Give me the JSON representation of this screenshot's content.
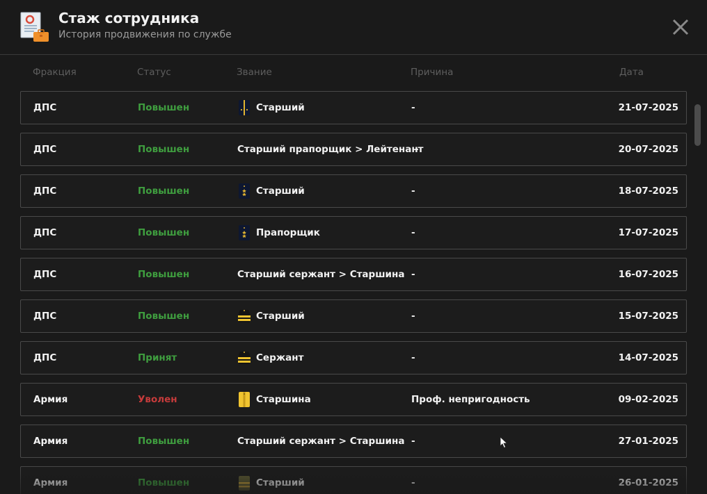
{
  "header": {
    "title": "Стаж сотрудника",
    "subtitle": "История продвижения по службе",
    "app_icon": "certificate-briefcase-icon",
    "close_icon": "close-icon"
  },
  "columns": {
    "faction": "Фракция",
    "status": "Статус",
    "rank": "Звание",
    "reason": "Причина",
    "date": "Дата"
  },
  "colors": {
    "promoted": "#3f9e3f",
    "fired": "#c63b3b",
    "background": "#1a1a1a"
  },
  "rows": [
    {
      "faction": "ДПС",
      "status": "Повышен",
      "status_type": "up",
      "rank_icon": "shoulder-strap-dark-one-stripe",
      "rank": "Старший",
      "reason": "-",
      "date": "21-07-2025"
    },
    {
      "faction": "ДПС",
      "status": "Повышен",
      "status_type": "up",
      "rank_icon": "",
      "rank": "Старший прапорщик > Лейтенант",
      "reason": "-",
      "date": "20-07-2025"
    },
    {
      "faction": "ДПС",
      "status": "Повышен",
      "status_type": "up",
      "rank_icon": "shoulder-strap-dark-stars",
      "rank": "Старший",
      "reason": "-",
      "date": "18-07-2025"
    },
    {
      "faction": "ДПС",
      "status": "Повышен",
      "status_type": "up",
      "rank_icon": "shoulder-strap-dark-stars",
      "rank": "Прапорщик",
      "reason": "-",
      "date": "17-07-2025"
    },
    {
      "faction": "ДПС",
      "status": "Повышен",
      "status_type": "up",
      "rank_icon": "",
      "rank": "Старший сержант > Старшина",
      "reason": "-",
      "date": "16-07-2025"
    },
    {
      "faction": "ДПС",
      "status": "Повышен",
      "status_type": "up",
      "rank_icon": "shoulder-strap-yellow-stripes",
      "rank": "Старший",
      "reason": "-",
      "date": "15-07-2025"
    },
    {
      "faction": "ДПС",
      "status": "Принят",
      "status_type": "up",
      "rank_icon": "shoulder-strap-yellow-stripes",
      "rank": "Сержант",
      "reason": "-",
      "date": "14-07-2025"
    },
    {
      "faction": "Армия",
      "status": "Уволен",
      "status_type": "fired",
      "rank_icon": "shoulder-strap-yellow-long",
      "rank": "Старшина",
      "reason": "Проф. непригодность",
      "date": "09-02-2025"
    },
    {
      "faction": "Армия",
      "status": "Повышен",
      "status_type": "up",
      "rank_icon": "",
      "rank": "Старший сержант > Старшина",
      "reason": "-",
      "date": "27-01-2025"
    },
    {
      "faction": "Армия",
      "status": "Повышен",
      "status_type": "up",
      "rank_icon": "shoulder-strap-olive-stripes",
      "rank": "Старший",
      "reason": "-",
      "date": "26-01-2025"
    }
  ]
}
